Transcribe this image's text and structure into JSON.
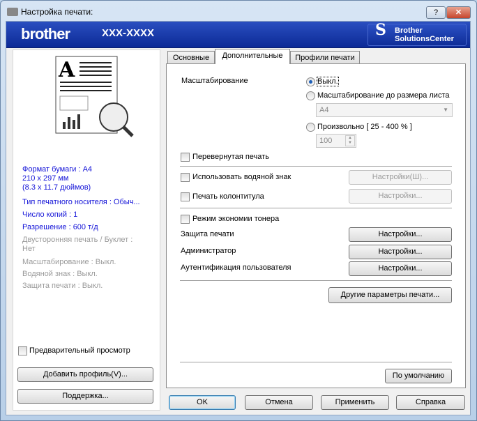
{
  "window": {
    "title": "Настройка печати:",
    "help_label": "?",
    "close_label": "✕"
  },
  "banner": {
    "logo": "brother",
    "model": "XXX-XXXX",
    "solutions_line1": "Brother",
    "solutions_line2": "SolutionsCenter"
  },
  "summary": {
    "paper": "Формат бумаги : A4",
    "size_mm": "210 x 297 мм",
    "size_in": "(8.3 x 11.7 дюймов)",
    "media": "Тип печатного носителя : Обыч...",
    "copies": "Число копий : 1",
    "resolution": "Разрешение : 600 т/д",
    "duplex1": "Двусторонняя печать / Буклет :",
    "duplex2": "Нет",
    "scaling": "Масштабирование : Выкл.",
    "watermark": "Водяной знак : Выкл.",
    "security": "Защита печати : Выкл."
  },
  "preview_label": "Предварительный просмотр",
  "add_profile": "Добавить профиль(V)...",
  "support": "Поддержка...",
  "tabs": [
    {
      "label": "Основные"
    },
    {
      "label": "Дополнительные"
    },
    {
      "label": "Профили печати"
    }
  ],
  "advanced": {
    "scaling_label": "Масштабирование",
    "off": "Выкл.",
    "fit": "Масштабирование до размера листа",
    "fit_value": "A4",
    "custom": "Произвольно [ 25 - 400 % ]",
    "custom_value": "100",
    "reverse": "Перевернутая печать",
    "watermark": "Использовать водяной знак",
    "watermark_settings": "Настройки(Ш)...",
    "header_footer": "Печать колонтитула",
    "hf_settings": "Настройки...",
    "toner_save": "Режим экономии тонера",
    "secure": "Защита печати",
    "secure_settings": "Настройки...",
    "admin": "Администратор",
    "admin_settings": "Настройки...",
    "auth": "Аутентификация пользователя",
    "auth_settings": "Настройки...",
    "other": "Другие параметры печати...",
    "default": "По умолчанию"
  },
  "footer": {
    "ok": "OK",
    "cancel": "Отмена",
    "apply": "Применить",
    "help": "Справка"
  }
}
